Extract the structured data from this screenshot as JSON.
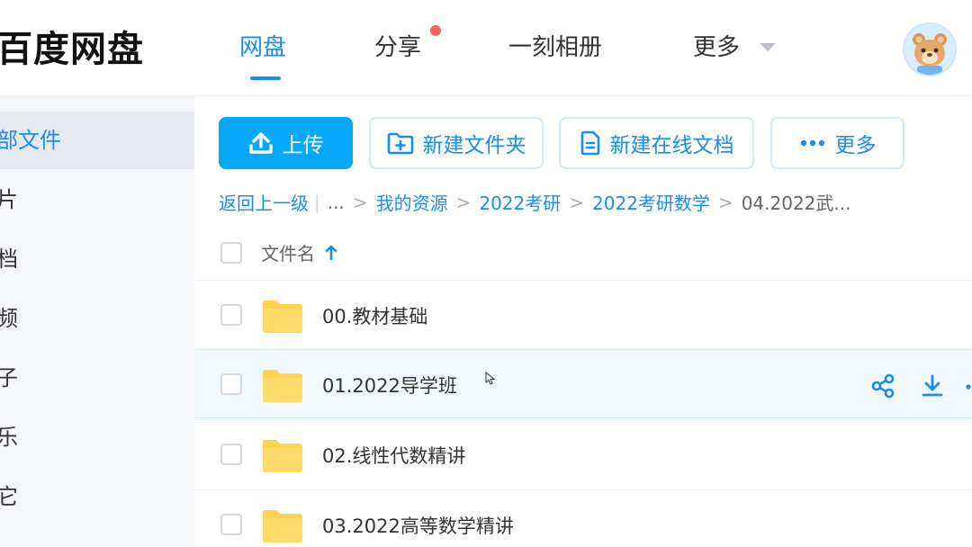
{
  "app": {
    "logo": "百度网盘"
  },
  "nav": {
    "tabs": [
      {
        "label": "网盘",
        "active": true
      },
      {
        "label": "分享",
        "has_notification": true
      },
      {
        "label": "一刻相册"
      },
      {
        "label": "更多"
      }
    ]
  },
  "sidebar": {
    "items": [
      {
        "label": "部文件",
        "active": true
      },
      {
        "label": "片"
      },
      {
        "label": "档"
      },
      {
        "label": "频"
      },
      {
        "label": "子"
      },
      {
        "label": "乐"
      },
      {
        "label": "它"
      }
    ]
  },
  "toolbar": {
    "upload_label": "上传",
    "new_folder_label": "新建文件夹",
    "new_doc_label": "新建在线文档",
    "more_label": "更多"
  },
  "breadcrumb": {
    "back": "返回上一级",
    "ellipsis": "...",
    "items": [
      "我的资源",
      "2022考研",
      "2022考研数学"
    ],
    "current": "04.2022武..."
  },
  "table": {
    "column_name": "文件名",
    "rows": [
      {
        "name": "00.教材基础"
      },
      {
        "name": "01.2022导学班",
        "hovered": true
      },
      {
        "name": "02.线性代数精讲"
      },
      {
        "name": "03.2022高等数学精讲"
      }
    ]
  },
  "colors": {
    "accent": "#1a8cf2",
    "upload_button": "#06a7ff",
    "folder": "#ffd24f",
    "notification_dot": "#f2645a",
    "sidebar_bg": "#f5f6fa",
    "hover_row": "#f1f8ff"
  },
  "icons": {
    "upload": "upload-icon",
    "new_folder": "folder-plus-icon",
    "new_doc": "document-icon",
    "more": "more-dots-icon",
    "sort": "arrow-up-icon",
    "share": "share-icon",
    "download": "download-icon"
  }
}
